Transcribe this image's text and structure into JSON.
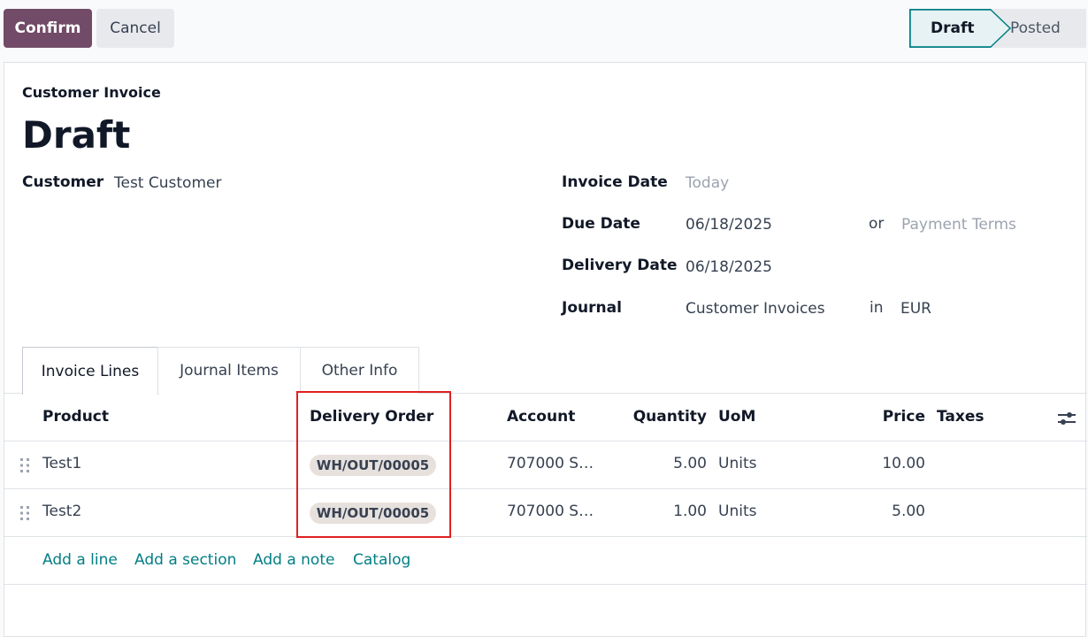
{
  "toolbar": {
    "confirm_label": "Confirm",
    "cancel_label": "Cancel"
  },
  "status": {
    "stages": [
      "Draft",
      "Posted"
    ],
    "current": "Draft"
  },
  "form": {
    "doc_type": "Customer Invoice",
    "doc_name": "Draft",
    "customer_label": "Customer",
    "customer_value": "Test Customer",
    "invoice_date_label": "Invoice Date",
    "invoice_date_placeholder": "Today",
    "due_date_label": "Due Date",
    "due_date_value": "06/18/2025",
    "or_text": "or",
    "payment_terms_placeholder": "Payment Terms",
    "delivery_date_label": "Delivery Date",
    "delivery_date_value": "06/18/2025",
    "journal_label": "Journal",
    "journal_value": "Customer Invoices",
    "in_text": "in",
    "currency_value": "EUR"
  },
  "tabs": [
    {
      "label": "Invoice Lines",
      "active": true
    },
    {
      "label": "Journal Items",
      "active": false
    },
    {
      "label": "Other Info",
      "active": false
    }
  ],
  "table": {
    "columns": [
      "Product",
      "Delivery Order",
      "Account",
      "Quantity",
      "UoM",
      "Price",
      "Taxes"
    ],
    "rows": [
      {
        "product": "Test1",
        "delivery_order": "WH/OUT/00005",
        "account": "707000 S…",
        "quantity": "5.00",
        "uom": "Units",
        "price": "10.00",
        "taxes": ""
      },
      {
        "product": "Test2",
        "delivery_order": "WH/OUT/00005",
        "account": "707000 S…",
        "quantity": "1.00",
        "uom": "Units",
        "price": "5.00",
        "taxes": ""
      }
    ],
    "add_links": [
      "Add a line",
      "Add a section",
      "Add a note",
      "Catalog"
    ]
  },
  "colors": {
    "brand": "#714b67",
    "accent": "#017e84",
    "highlight": "#e02020"
  },
  "icons": {
    "row_handle": "drag-handle-icon",
    "column_settings": "sliders-icon"
  }
}
